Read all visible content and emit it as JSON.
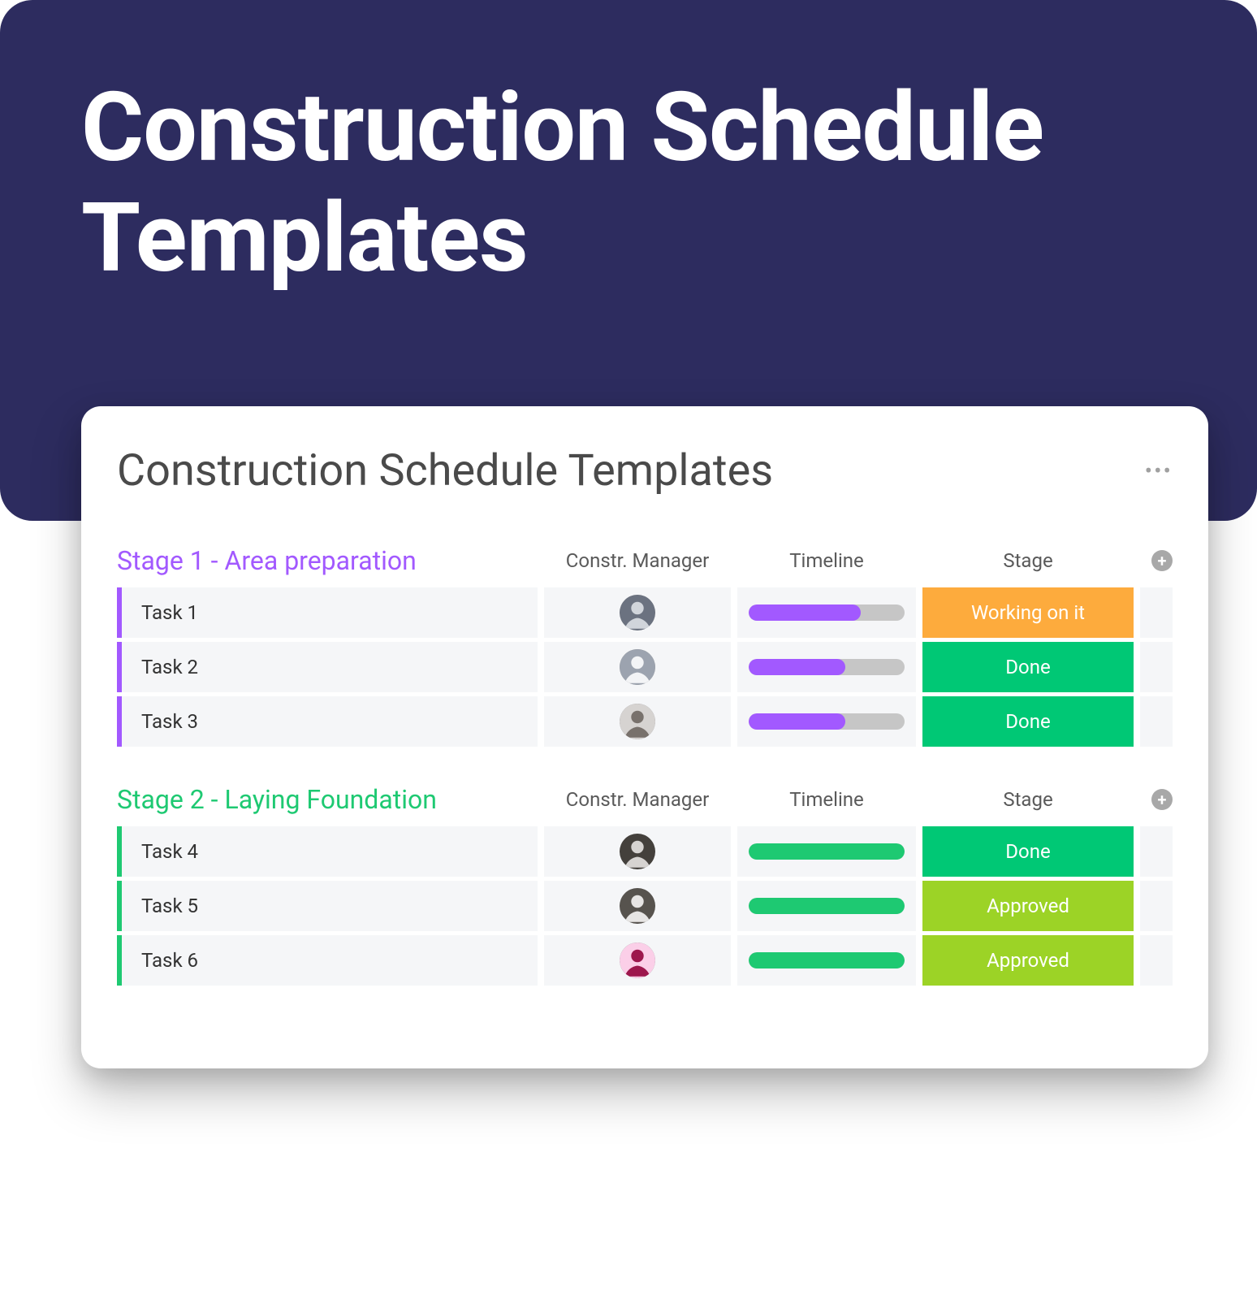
{
  "hero": {
    "title": "Construction Schedule Templates"
  },
  "card": {
    "title": "Construction Schedule Templates"
  },
  "columns": {
    "manager": "Constr. Manager",
    "timeline": "Timeline",
    "stage": "Stage"
  },
  "groups": [
    {
      "title": "Stage 1 - Area preparation",
      "color": "purple",
      "rows": [
        {
          "task": "Task 1",
          "timeline_pct": 72,
          "stage_label": "Working on it",
          "stage_color": "orange"
        },
        {
          "task": "Task 2",
          "timeline_pct": 62,
          "stage_label": "Done",
          "stage_color": "green"
        },
        {
          "task": "Task 3",
          "timeline_pct": 62,
          "stage_label": "Done",
          "stage_color": "green"
        }
      ]
    },
    {
      "title": "Stage 2 - Laying Foundation",
      "color": "green",
      "rows": [
        {
          "task": "Task 4",
          "timeline_pct": 100,
          "stage_label": "Done",
          "stage_color": "green"
        },
        {
          "task": "Task 5",
          "timeline_pct": 100,
          "stage_label": "Approved",
          "stage_color": "lime"
        },
        {
          "task": "Task 6",
          "timeline_pct": 100,
          "stage_label": "Approved",
          "stage_color": "lime"
        }
      ]
    }
  ]
}
